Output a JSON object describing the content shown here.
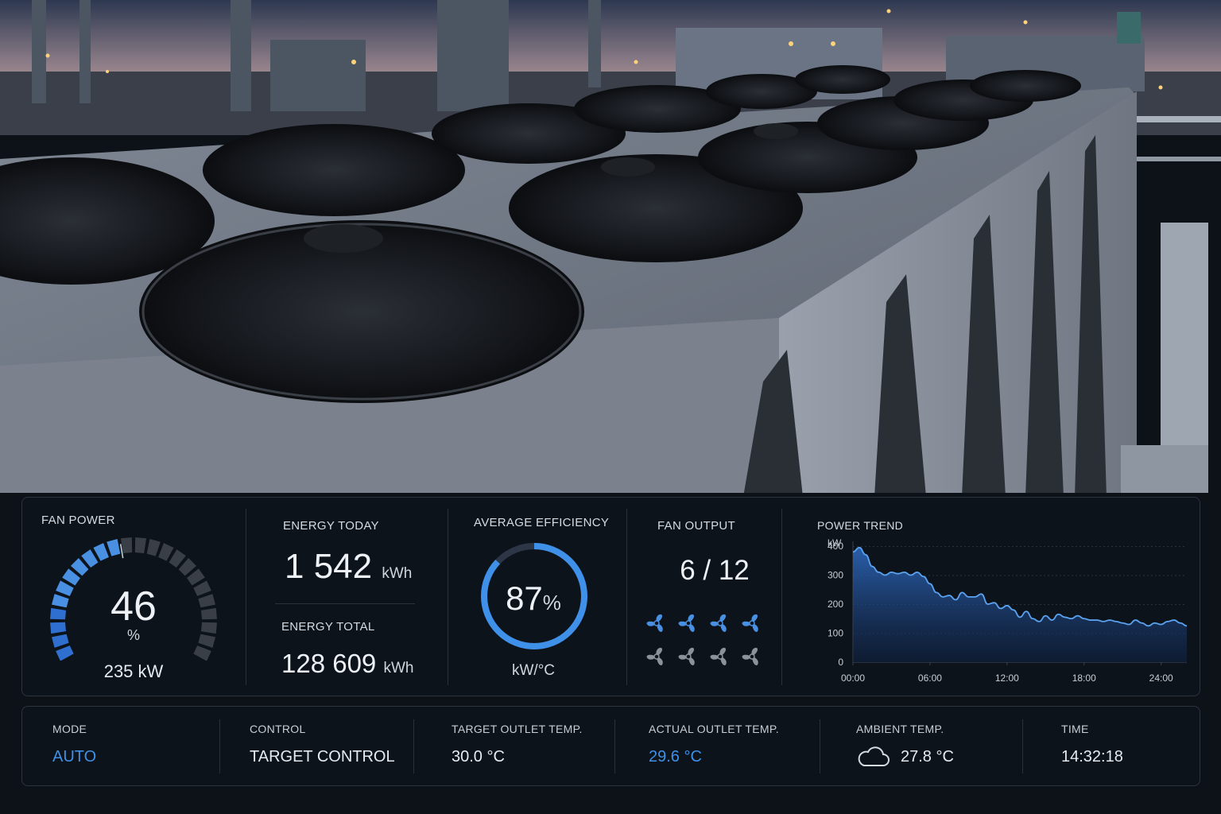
{
  "colors": {
    "accent": "#3f90e8",
    "gauge_inactive": "#3a3f47",
    "panel_bg": "#0e131b",
    "text": "#e6ebf2"
  },
  "fan_power": {
    "label": "FAN POWER",
    "value": "46",
    "unit": "%",
    "level_percent": 46,
    "power": "235 kW"
  },
  "energy_today": {
    "label": "ENERGY TODAY",
    "value": "1 542",
    "unit": "kWh"
  },
  "energy_total": {
    "label": "ENERGY TOTAL",
    "value": "128 609",
    "unit": "kWh"
  },
  "efficiency": {
    "label": "AVERAGE EFFICIENCY",
    "value": "87",
    "unit": "%",
    "sub_unit": "kW/°C",
    "level_percent": 87
  },
  "fan_output": {
    "label": "FAN OUTPUT",
    "value": "6 / 12",
    "active": 6,
    "total": 12,
    "icon": "fan-icon"
  },
  "chart_data": {
    "type": "area",
    "title": "POWER TREND",
    "ylabel": "kW",
    "xlabel": "",
    "ylim": [
      0,
      400
    ],
    "yticks": [
      0,
      100,
      200,
      300,
      400
    ],
    "xlim": [
      0,
      26
    ],
    "xticks": [
      0,
      6,
      12,
      18,
      24
    ],
    "xtick_labels": [
      "00:00",
      "06:00",
      "12:00",
      "18:00",
      "24:00"
    ],
    "grid": true,
    "series": [
      {
        "x": [
          0,
          0.5,
          1,
          1.5,
          2,
          2.5,
          3,
          3.5,
          4,
          4.5,
          5,
          5.5,
          6,
          6.5,
          7,
          7.5,
          8,
          8.5,
          9,
          9.5,
          10,
          10.5,
          11,
          11.5,
          12,
          12.5,
          13,
          13.5,
          14,
          14.5,
          15,
          15.5,
          16,
          16.5,
          17,
          17.5,
          18,
          18.5,
          19,
          19.5,
          20,
          20.5,
          21,
          21.5,
          22,
          22.5,
          23,
          23.5,
          24,
          24.5,
          25,
          25.5,
          26
        ],
        "values": [
          380,
          395,
          370,
          330,
          310,
          300,
          310,
          305,
          310,
          300,
          310,
          295,
          270,
          240,
          225,
          230,
          215,
          240,
          225,
          225,
          235,
          200,
          205,
          185,
          195,
          180,
          155,
          175,
          150,
          140,
          160,
          145,
          165,
          155,
          150,
          160,
          150,
          145,
          145,
          140,
          145,
          140,
          135,
          130,
          145,
          135,
          125,
          135,
          130,
          140,
          145,
          135,
          125
        ]
      }
    ]
  },
  "status": {
    "mode": {
      "label": "MODE",
      "value": "AUTO"
    },
    "control": {
      "label": "CONTROL",
      "value": "TARGET CONTROL"
    },
    "target_temp": {
      "label": "TARGET OUTLET TEMP.",
      "value": "30.0 °C"
    },
    "actual_temp": {
      "label": "ACTUAL OUTLET TEMP.",
      "value": "29.6 °C"
    },
    "ambient_temp": {
      "label": "AMBIENT TEMP.",
      "value": "27.8 °C",
      "icon": "cloud-icon"
    },
    "time": {
      "label": "TIME",
      "value": "14:32:18"
    }
  }
}
